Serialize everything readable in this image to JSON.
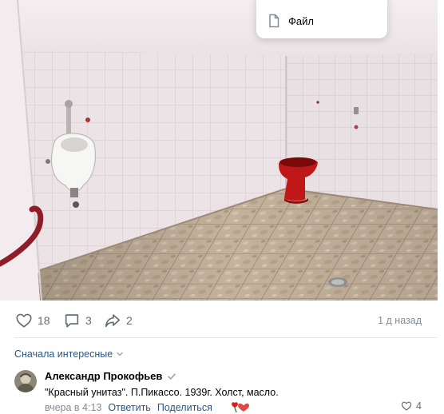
{
  "dropdown": {
    "file_label": "Файл"
  },
  "post": {
    "likes": "18",
    "comments": "3",
    "shares": "2",
    "time": "1 д назад"
  },
  "comments": {
    "sort_label": "Сначала интересные",
    "item": {
      "author": "Александр Прокофьев",
      "text": "\"Красный унитаз\". П.Пикассо. 1939г. Холст, масло.",
      "time": "вчера в 4:13",
      "reply_label": "Ответить",
      "share_label": "Поделиться",
      "likes": "4"
    }
  },
  "colors": {
    "link": "#2a5885",
    "muted": "#818c99",
    "icon": "#626d7a"
  }
}
